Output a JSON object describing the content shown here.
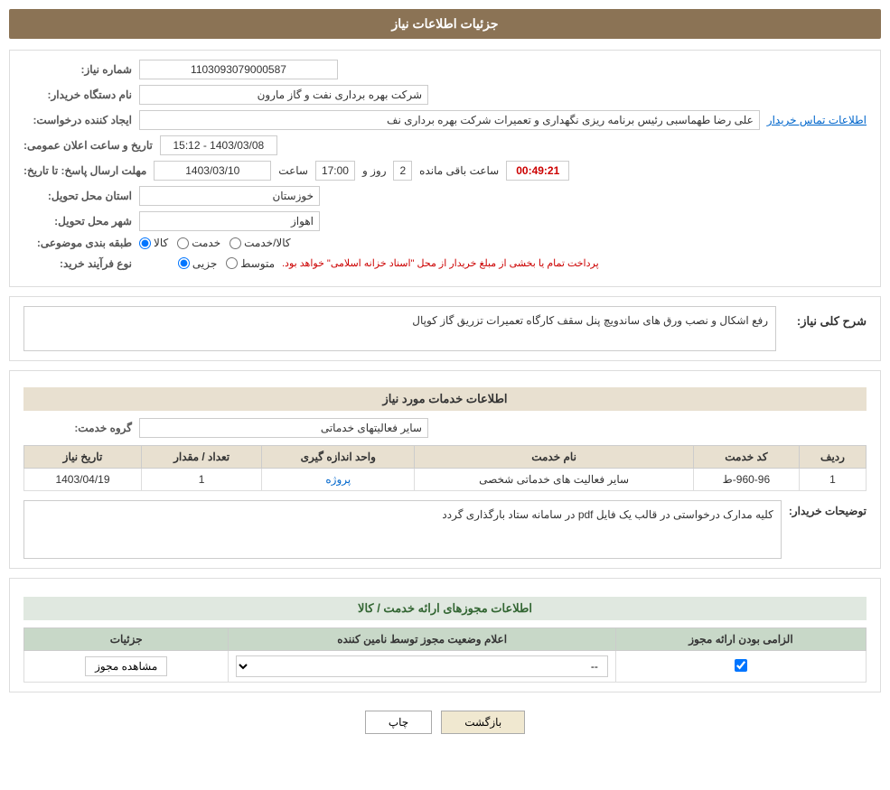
{
  "header": {
    "title": "جزئیات اطلاعات نیاز"
  },
  "fields": {
    "need_number_label": "شماره نیاز:",
    "need_number_value": "1103093079000587",
    "buyer_org_label": "نام دستگاه خریدار:",
    "buyer_org_value": "شرکت بهره برداری نفت و گاز مارون",
    "creator_label": "ایجاد کننده درخواست:",
    "creator_value": "علی رضا طهماسبی رئیس برنامه ریزی نگهداری و تعمیرات شرکت بهره برداری نف",
    "contact_link": "اطلاعات تماس خریدار",
    "announce_label": "تاریخ و ساعت اعلان عمومی:",
    "announce_value": "1403/03/08 - 15:12",
    "deadline_label": "مهلت ارسال پاسخ: تا تاریخ:",
    "deadline_date": "1403/03/10",
    "deadline_time_label": "ساعت",
    "deadline_time": "17:00",
    "deadline_day_label": "روز و",
    "deadline_days": "2",
    "countdown_label": "ساعت باقی مانده",
    "countdown_value": "00:49:21",
    "province_label": "استان محل تحویل:",
    "province_value": "خوزستان",
    "city_label": "شهر محل تحویل:",
    "city_value": "اهواز",
    "category_label": "طبقه بندی موضوعی:",
    "category_options": [
      "کالا",
      "خدمت",
      "کالا/خدمت"
    ],
    "category_selected": "کالا",
    "purchase_type_label": "نوع فرآیند خرید:",
    "purchase_type_options": [
      "جزیی",
      "متوسط"
    ],
    "purchase_type_selected": "جزیی",
    "purchase_type_note": "پرداخت تمام یا بخشی از مبلغ خریدار از محل \"اسناد خزانه اسلامی\" خواهد بود."
  },
  "need_description": {
    "title": "شرح کلی نیاز:",
    "value": "رفع اشکال و نصب ورق های ساندویچ پنل سقف کارگاه تعمیرات تزریق گاز کوپال"
  },
  "services_section": {
    "title": "اطلاعات خدمات مورد نیاز",
    "service_group_label": "گروه خدمت:",
    "service_group_value": "سایر فعالیتهای خدماتی",
    "table": {
      "headers": [
        "ردیف",
        "کد خدمت",
        "نام خدمت",
        "واحد اندازه گیری",
        "تعداد / مقدار",
        "تاریخ نیاز"
      ],
      "rows": [
        {
          "row": "1",
          "code": "960-96-ط",
          "name": "سایر فعالیت های خدماتی شخصی",
          "unit": "پروژه",
          "quantity": "1",
          "date": "1403/04/19"
        }
      ]
    }
  },
  "buyer_notes": {
    "label": "توضیحات خریدار:",
    "value": "کلیه مدارک درخواستی در قالب یک فایل pdf در سامانه ستاد بارگذاری گردد"
  },
  "permits_section": {
    "title": "اطلاعات مجوزهای ارائه خدمت / کالا",
    "table": {
      "headers": [
        "الزامی بودن ارائه مجوز",
        "اعلام وضعیت مجوز توسط نامین کننده",
        "جزئیات"
      ],
      "rows": [
        {
          "required": true,
          "status_options": [
            "--"
          ],
          "status_selected": "--",
          "detail_btn": "مشاهده مجوز"
        }
      ]
    }
  },
  "buttons": {
    "print": "چاپ",
    "back": "بازگشت"
  }
}
